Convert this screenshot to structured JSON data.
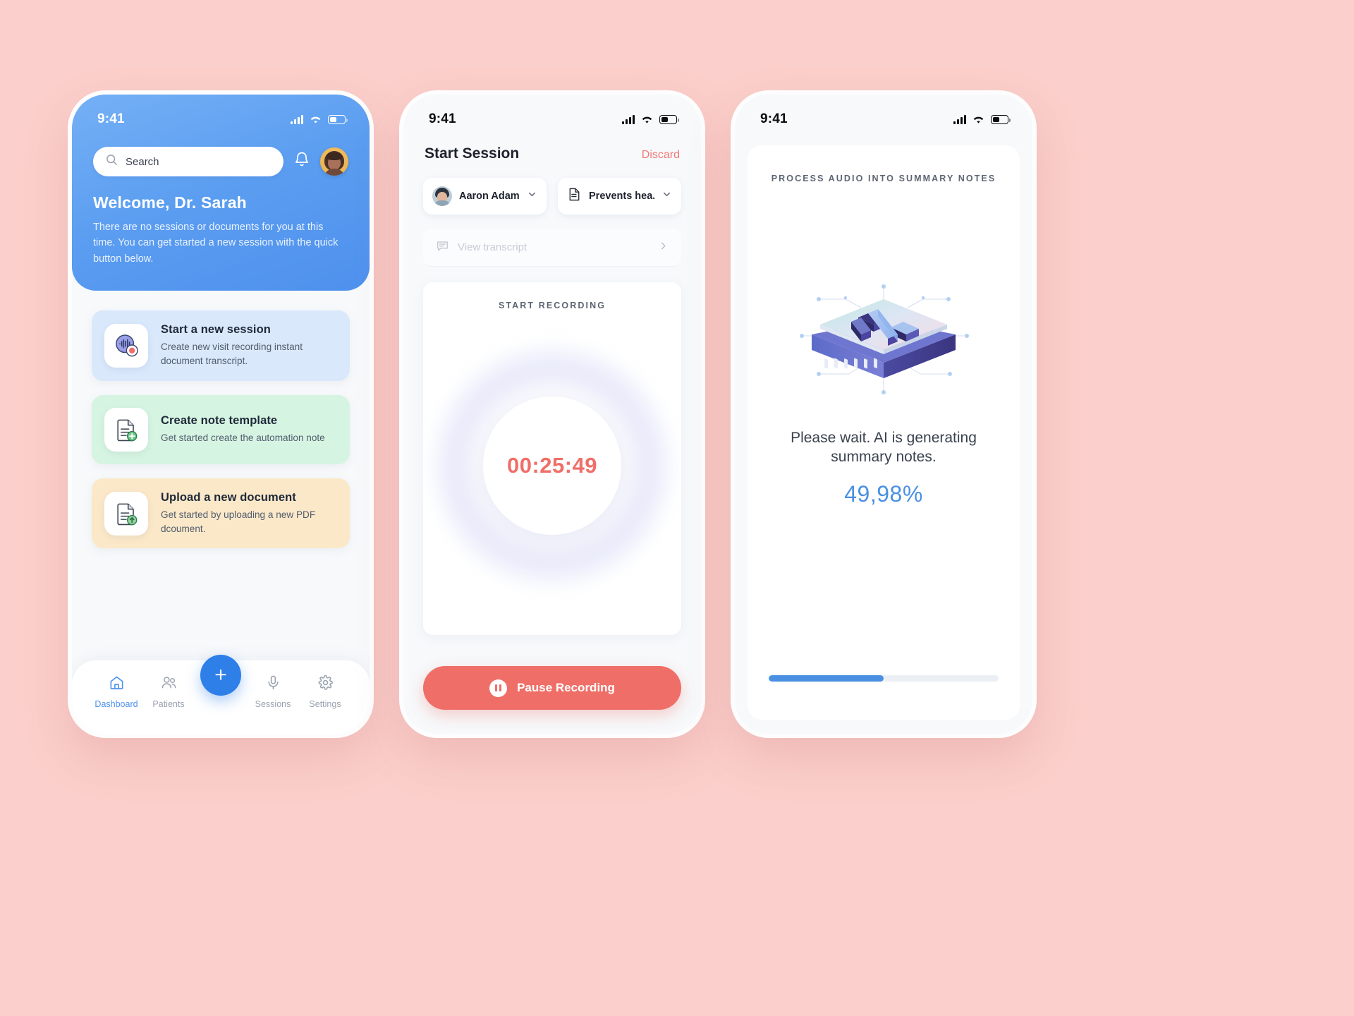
{
  "theme": {
    "page_background": "#fbcfcb",
    "brand_blue": "#4e91ee",
    "accent_red": "#ef6f68",
    "progress_blue": "#4a90e2"
  },
  "phone1": {
    "name": "dashboard-screen",
    "status_bar": {
      "time": "9:41",
      "icons": [
        "signal-icon",
        "wifi-icon",
        "battery-icon"
      ]
    },
    "search": {
      "placeholder": "Search",
      "icon": "search-icon"
    },
    "notifications_icon": "bell-icon",
    "avatar": "user-avatar",
    "welcome_title": "Welcome, Dr. Sarah",
    "welcome_body": "There are no sessions or documents for you at this time. You can get started a new session with the quick button below.",
    "cards": [
      {
        "title": "Start a new session",
        "desc": "Create new visit recording instant document transcript.",
        "icon": "audio-waveform-record-icon",
        "color": "#d9e8fb"
      },
      {
        "title": "Create note template",
        "desc": "Get started create the automation note",
        "icon": "document-add-icon",
        "color": "#d6f4e2"
      },
      {
        "title": "Upload a new document",
        "desc": "Get started by uploading a new PDF dcoument.",
        "icon": "document-upload-icon",
        "color": "#fbe8c8"
      }
    ],
    "tabs": [
      {
        "label": "Dashboard",
        "icon": "home-icon",
        "active": true
      },
      {
        "label": "Patients",
        "icon": "people-icon",
        "active": false
      },
      {
        "label": "Sessions",
        "icon": "microphone-icon",
        "active": false
      },
      {
        "label": "Settings",
        "icon": "gear-icon",
        "active": false
      }
    ],
    "fab": {
      "label": "+",
      "icon": "plus-icon"
    }
  },
  "phone2": {
    "name": "recording-screen",
    "status_bar": {
      "time": "9:41",
      "icons": [
        "signal-icon",
        "wifi-icon",
        "battery-icon"
      ]
    },
    "title": "Start Session",
    "discard_label": "Discard",
    "patient_select": {
      "value": "Aaron Adams",
      "icon": "patient-avatar",
      "chevron": "chevron-down-icon"
    },
    "template_select": {
      "value": "Prevents hea...",
      "icon": "document-icon",
      "chevron": "chevron-down-icon"
    },
    "transcript_row": {
      "label": "View transcript",
      "icon": "chat-bubble-icon",
      "chevron": "chevron-right-icon"
    },
    "recording": {
      "label": "START RECORDING",
      "timer": "00:25:49"
    },
    "pause_button": {
      "label": "Pause Recording",
      "icon": "pause-icon"
    }
  },
  "phone3": {
    "name": "processing-screen",
    "status_bar": {
      "time": "9:41",
      "icons": [
        "signal-icon",
        "wifi-icon",
        "battery-icon"
      ]
    },
    "kicker": "PROCESS AUDIO INTO SUMMARY NOTES",
    "illustration": "ai-chip-icon",
    "illustration_label": "AI",
    "message": "Please wait. AI is generating summary notes.",
    "percent_label": "49,98%",
    "progress": {
      "value": 49.98,
      "max": 100
    }
  }
}
